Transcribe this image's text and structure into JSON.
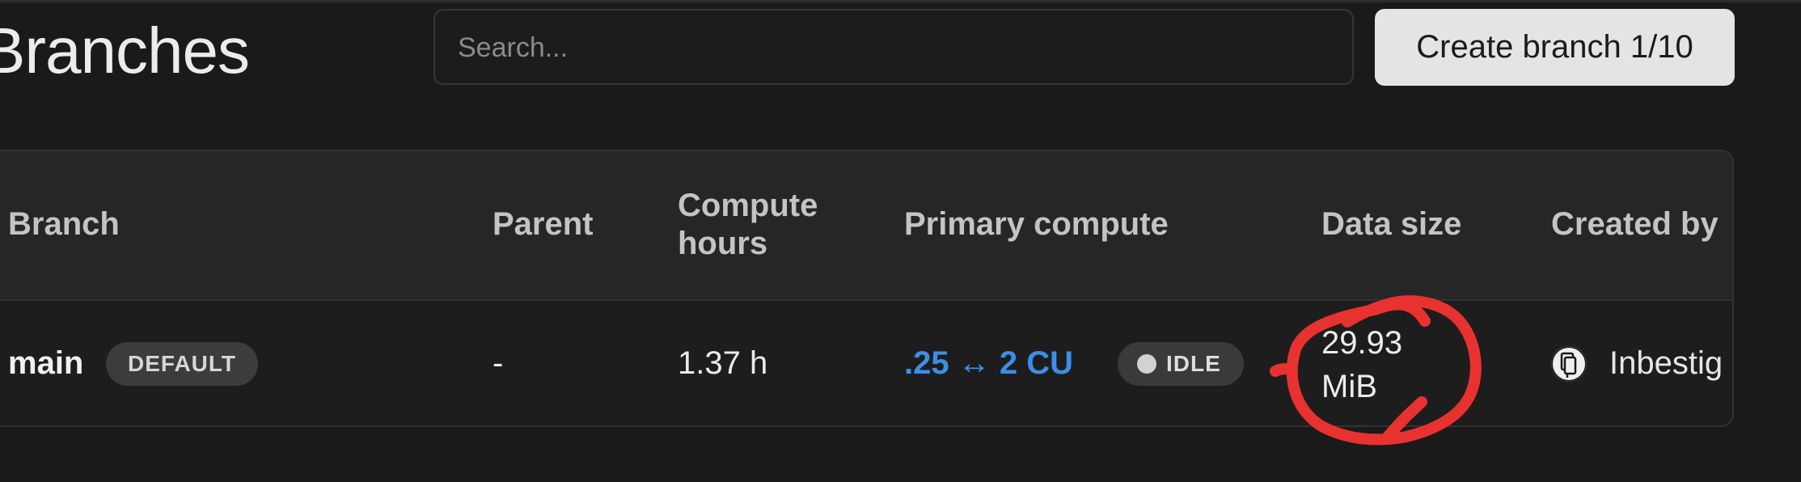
{
  "page": {
    "title": "Branches"
  },
  "search": {
    "placeholder": "Search..."
  },
  "toolbar": {
    "create_branch_label": "Create branch 1/10"
  },
  "table": {
    "columns": [
      "Branch",
      "Parent",
      "Compute hours",
      "Primary compute",
      "Data size",
      "Created by"
    ],
    "rows": [
      {
        "branch": "main",
        "badge": "DEFAULT",
        "parent": "-",
        "compute_hours": "1.37 h",
        "primary_compute": ".25 ↔ 2 CU",
        "compute_status": "IDLE",
        "data_size": "29.93 MiB",
        "created_by": "Inbestig"
      }
    ]
  },
  "colors": {
    "background": "#1a1a1a",
    "link_blue": "#3b8fe8",
    "annotation_red": "#e8322f"
  },
  "icons": {
    "creator_avatar": "avatar-icon",
    "status_dot": "status-dot-icon"
  }
}
